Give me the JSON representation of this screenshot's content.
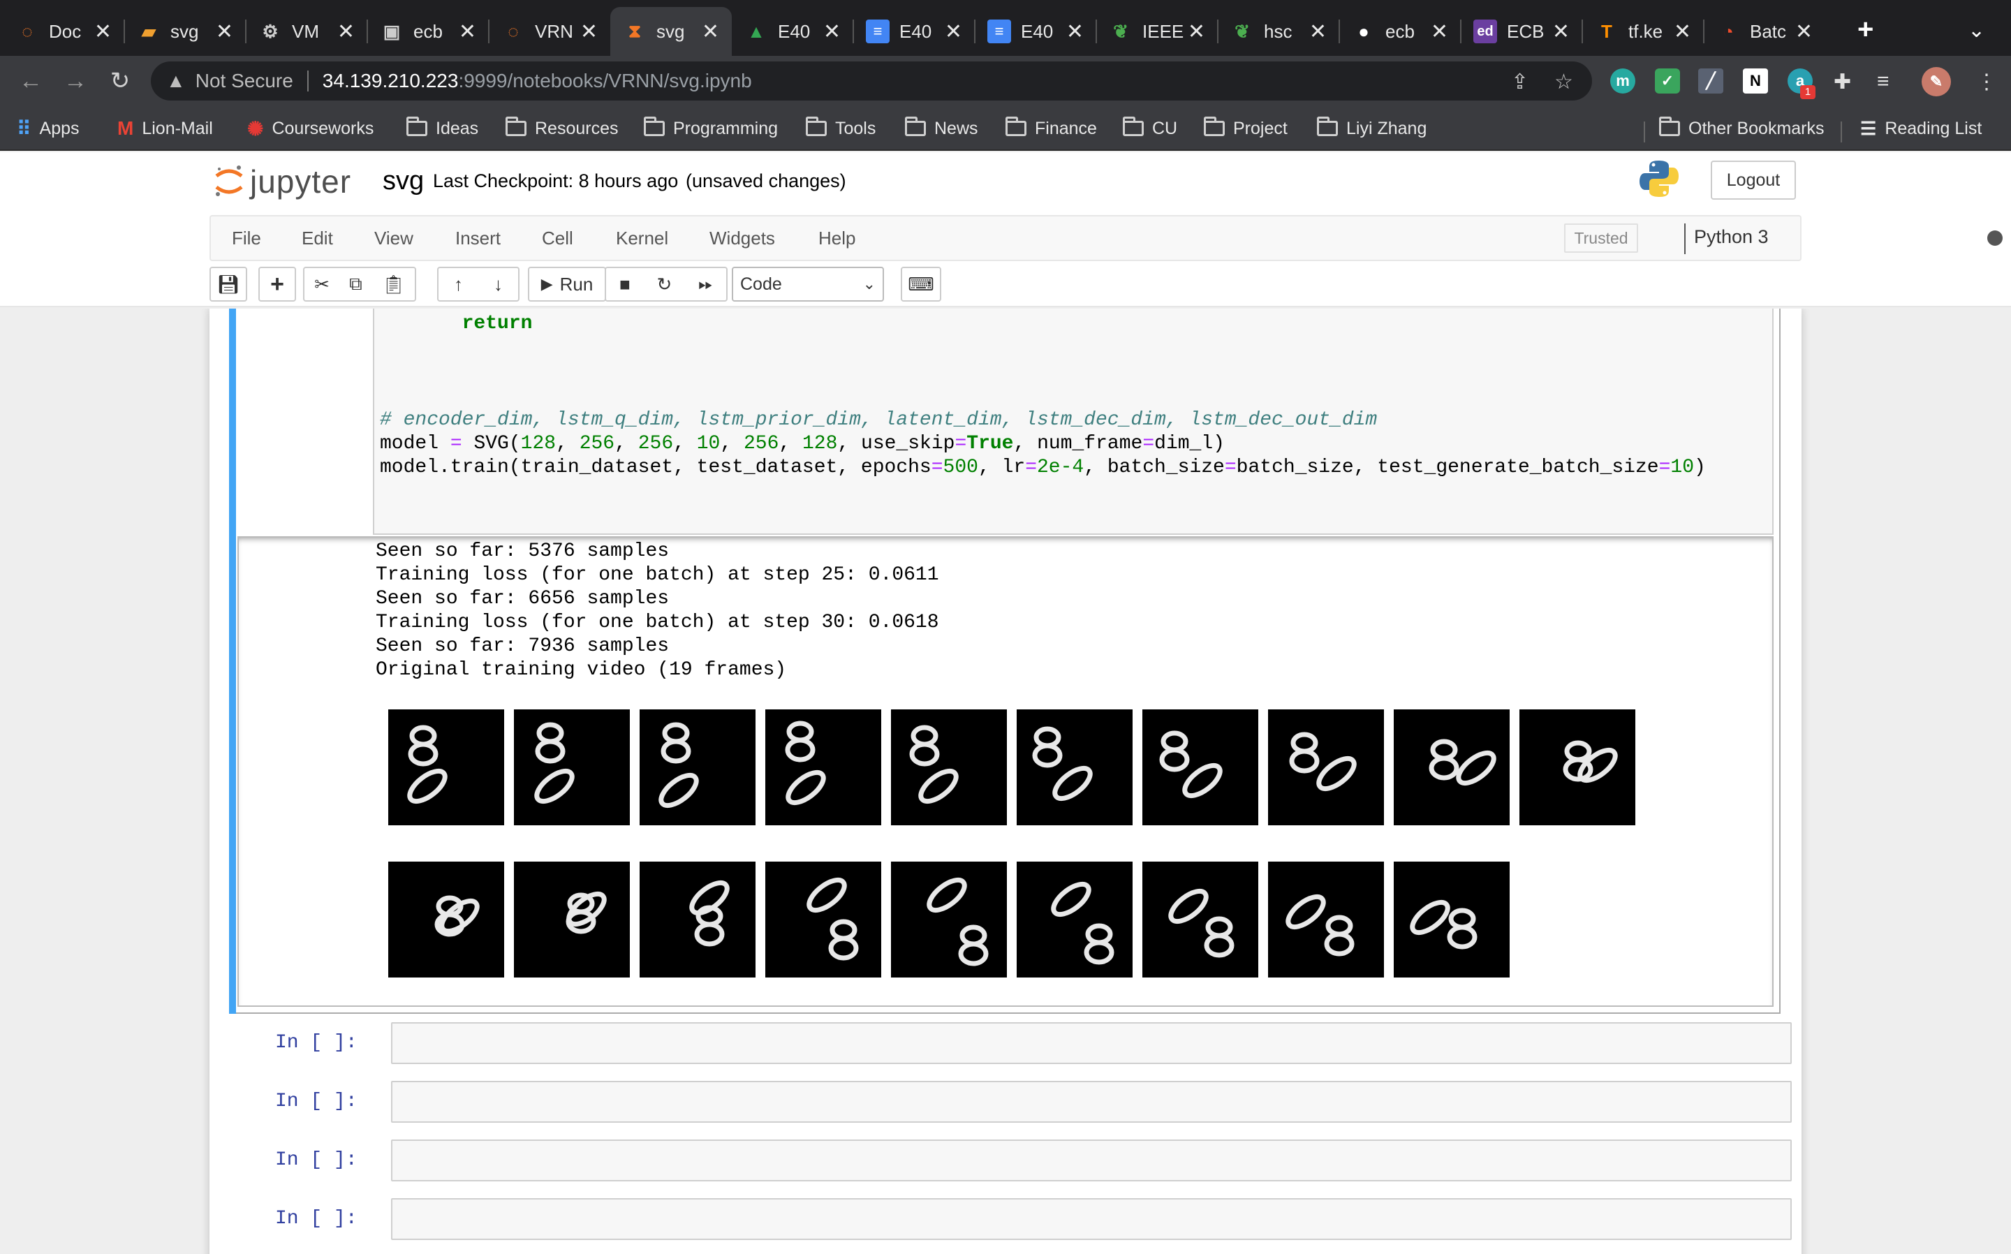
{
  "browser": {
    "tabs": [
      {
        "label": "Doc",
        "icon": "jupyter-icon"
      },
      {
        "label": "svg",
        "icon": "book-icon"
      },
      {
        "label": "VM",
        "icon": "gear-icon"
      },
      {
        "label": "ecb",
        "icon": "chip-icon"
      },
      {
        "label": "VRN",
        "icon": "jupyter-icon"
      },
      {
        "label": "svg",
        "icon": "hourglass-icon"
      },
      {
        "label": "E40",
        "icon": "drive-icon"
      },
      {
        "label": "E40",
        "icon": "docs-icon"
      },
      {
        "label": "E40",
        "icon": "docs-icon"
      },
      {
        "label": "IEEE",
        "icon": "leaf-icon"
      },
      {
        "label": "hsc",
        "icon": "leaf-icon"
      },
      {
        "label": "ecb",
        "icon": "github-icon"
      },
      {
        "label": "ECB",
        "icon": "ed-icon"
      },
      {
        "label": "tf.ke",
        "icon": "tensorflow-icon"
      },
      {
        "label": "Batc",
        "icon": "pytorch-icon"
      }
    ],
    "active_tab": 5,
    "address": {
      "security": "Not Secure",
      "host": "34.139.210.223",
      "path": ":9999/notebooks/VRNN/svg.ipynb"
    },
    "bookmarks": [
      {
        "label": "Apps",
        "type": "apps"
      },
      {
        "label": "Lion-Mail",
        "type": "gmail"
      },
      {
        "label": "Courseworks",
        "type": "site"
      },
      {
        "label": "Ideas",
        "type": "folder"
      },
      {
        "label": "Resources",
        "type": "folder"
      },
      {
        "label": "Programming",
        "type": "folder"
      },
      {
        "label": "Tools",
        "type": "folder"
      },
      {
        "label": "News",
        "type": "folder"
      },
      {
        "label": "Finance",
        "type": "folder"
      },
      {
        "label": "CU",
        "type": "folder"
      },
      {
        "label": "Project",
        "type": "folder"
      },
      {
        "label": "Liyi Zhang",
        "type": "folder"
      }
    ],
    "other_bookmarks": "Other Bookmarks",
    "reading_list": "Reading List",
    "extension_badge": "1"
  },
  "jupyter": {
    "logo_text": "jupyter",
    "notebook_name": "svg",
    "checkpoint": "Last Checkpoint: 8 hours ago",
    "status": "(unsaved changes)",
    "logout": "Logout",
    "menu": [
      "File",
      "Edit",
      "View",
      "Insert",
      "Cell",
      "Kernel",
      "Widgets",
      "Help"
    ],
    "trusted": "Trusted",
    "kernel": "Python 3",
    "run_label": "Run",
    "cell_type": "Code"
  },
  "cell": {
    "code_return": "return",
    "code_comment": "# encoder_dim, lstm_q_dim, lstm_prior_dim, latent_dim, lstm_dec_dim, lstm_dec_out_dim",
    "code_model": "model = SVG(128, 256, 256, 10, 256, 128, use_skip=True, num_frame=dim_l)",
    "code_train": "model.train(train_dataset, test_dataset, epochs=500, lr=2e-4, batch_size=batch_size, test_generate_batch_size=10)",
    "output_lines": [
      "Seen so far: 5376 samples",
      "Training loss (for one batch) at step 25: 0.0611",
      "Seen so far: 6656 samples",
      "Training loss (for one batch) at step 30: 0.0618",
      "Seen so far: 7936 samples",
      "Original training video (19 frames)"
    ],
    "frame_count": 19
  },
  "empty_cells": [
    {
      "prompt": "In [ ]:"
    },
    {
      "prompt": "In [ ]:"
    },
    {
      "prompt": "In [ ]:"
    },
    {
      "prompt": "In [ ]:"
    }
  ]
}
